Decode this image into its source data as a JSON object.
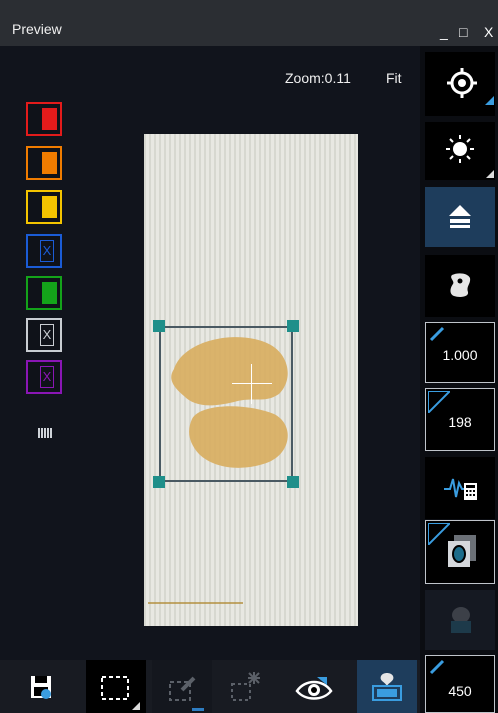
{
  "window": {
    "title": "Preview",
    "minimize": "_",
    "maximize": "□",
    "close": "X"
  },
  "view": {
    "zoom_label": "Zoom:0.11",
    "fit_label": "Fit"
  },
  "color_filters": [
    {
      "name": "red",
      "color": "#e31b1b"
    },
    {
      "name": "orange",
      "color": "#f07c00"
    },
    {
      "name": "yellow",
      "color": "#f4c400"
    },
    {
      "name": "blue",
      "color": "#1b5cd6",
      "disabled": true
    },
    {
      "name": "green",
      "color": "#14a31a"
    },
    {
      "name": "gray",
      "color": "#c9cdd2",
      "disabled": true
    },
    {
      "name": "purple",
      "color": "#8a16b5",
      "disabled": true
    }
  ],
  "right_panel": {
    "value_1": "1.000",
    "value_2": "198",
    "value_3": "450"
  },
  "colors": {
    "accent": "#1f8f8a",
    "active_bg": "#1e3d5c",
    "tissue": "#d8ad5e"
  }
}
